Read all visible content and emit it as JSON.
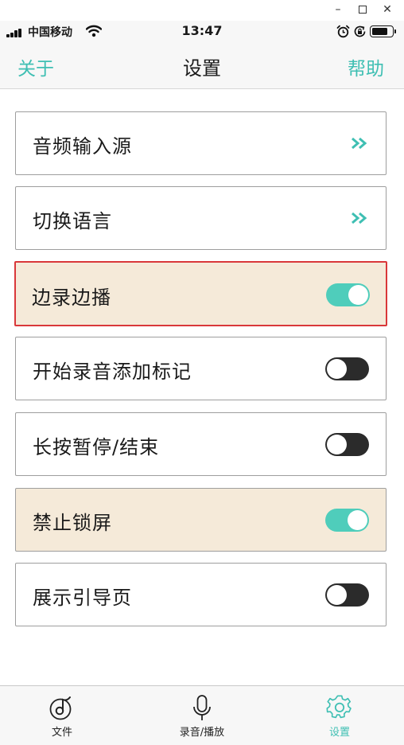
{
  "window": {
    "minimize": "–",
    "close": "✕"
  },
  "status_bar": {
    "carrier": "中国移动",
    "time": "13:47",
    "battery_level": 0.85,
    "icons": [
      "signal-icon",
      "wifi-icon",
      "alarm-icon",
      "rotation-lock-icon",
      "battery-icon"
    ]
  },
  "nav": {
    "left": "关于",
    "title": "设置",
    "right": "帮助"
  },
  "accent_color": "#3fbfb3",
  "settings": {
    "items": [
      {
        "label": "音频输入源",
        "control": "chevron",
        "icon": "double-chevron-right-icon"
      },
      {
        "label": "切换语言",
        "control": "chevron",
        "icon": "double-chevron-right-icon"
      },
      {
        "label": "边录边播",
        "control": "toggle",
        "value": true,
        "highlighted": true,
        "selected": true
      },
      {
        "label": "开始录音添加标记",
        "control": "toggle",
        "value": false
      },
      {
        "label": "长按暂停/结束",
        "control": "toggle",
        "value": false
      },
      {
        "label": "禁止锁屏",
        "control": "toggle",
        "value": true,
        "highlighted": true
      },
      {
        "label": "展示引导页",
        "control": "toggle",
        "value": false
      }
    ]
  },
  "tab_bar": {
    "tabs": [
      {
        "label": "文件",
        "icon": "music-note-icon",
        "active": false
      },
      {
        "label": "录音/播放",
        "icon": "microphone-icon",
        "active": false
      },
      {
        "label": "设置",
        "icon": "gear-icon",
        "active": true
      }
    ]
  }
}
